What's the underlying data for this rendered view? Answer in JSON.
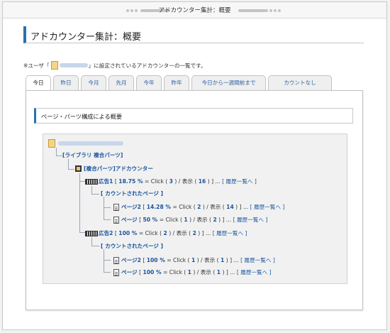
{
  "window": {
    "title": "アドカウンター集計：概要"
  },
  "page": {
    "heading": "アドカウンター集計：概要",
    "note_prefix": "※ユーザ「",
    "note_suffix": "」に設定されているアドカウンターの一覧です。"
  },
  "tabs": [
    {
      "label": "今日",
      "active": true
    },
    {
      "label": "昨日",
      "active": false
    },
    {
      "label": "今月",
      "active": false
    },
    {
      "label": "先月",
      "active": false
    },
    {
      "label": "今年",
      "active": false
    },
    {
      "label": "昨年",
      "active": false
    },
    {
      "label": "今日から一週間前まで",
      "active": false
    },
    {
      "label": "カウントなし",
      "active": false
    }
  ],
  "section": {
    "title": "ページ・パーツ構成による概要"
  },
  "tree": {
    "library": "[ライブラリ 複合パーツ]",
    "composite": "[複合パーツ]アドカウンター",
    "counted_pages": "[ カウントされたページ ]",
    "ad1": {
      "name": "広告1",
      "pct": "18.75 %",
      "clicks": "3",
      "views": "16",
      "pages": [
        {
          "name": "ページ2",
          "pct": "14.28 %",
          "clicks": "2",
          "views": "14"
        },
        {
          "name": "ページ",
          "pct": "50 %",
          "clicks": "1",
          "views": "2"
        }
      ]
    },
    "ad2": {
      "name": "広告2",
      "pct": "100 %",
      "clicks": "2",
      "views": "2",
      "pages": [
        {
          "name": "ページ2",
          "pct": "100 %",
          "clicks": "1",
          "views": "1"
        },
        {
          "name": "ページ",
          "pct": "100 %",
          "clicks": "1",
          "views": "1"
        }
      ]
    },
    "labels": {
      "open_br": "[",
      "eq_click": "= Click (",
      "slash_view": ") / 表示 (",
      "close": ") ] ...",
      "history": "[ 履歴一覧へ ]"
    }
  }
}
